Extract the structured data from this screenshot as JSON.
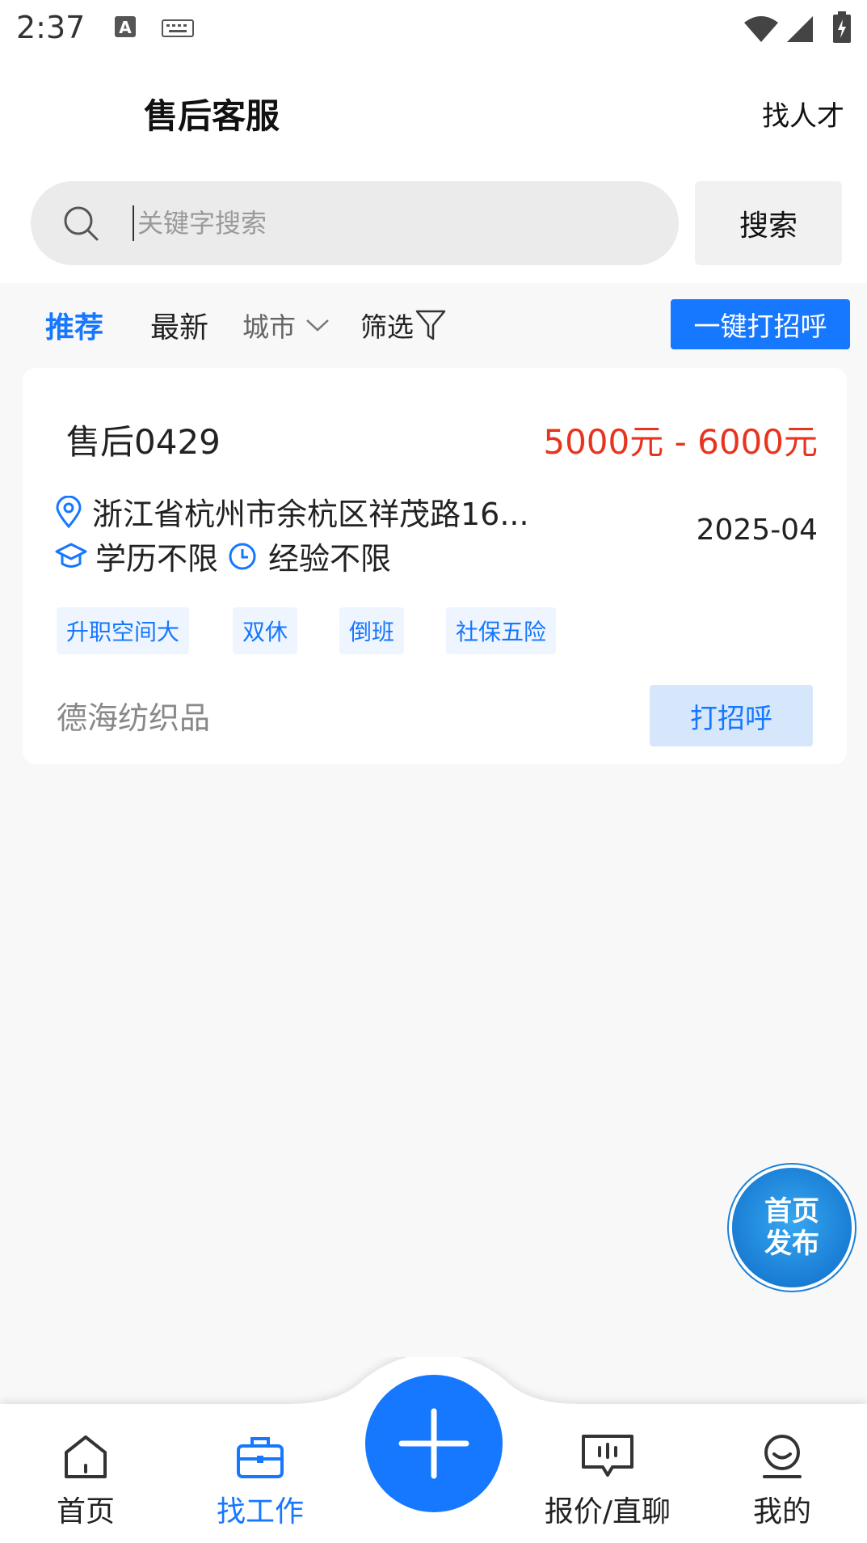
{
  "status_bar": {
    "time": "2:37"
  },
  "header": {
    "title": "售后客服",
    "find_talent": "找人才"
  },
  "search": {
    "placeholder": "关键字搜索",
    "button_label": "搜索"
  },
  "filters": {
    "tab_recommend": "推荐",
    "tab_latest": "最新",
    "city": "城市",
    "filter": "筛选",
    "greet_all": "一键打招呼"
  },
  "job": {
    "title": "售后0429",
    "salary": "5000元 - 6000元",
    "address": "浙江省杭州市余杭区祥茂路16...",
    "education": "学历不限",
    "experience": "经验不限",
    "date": "2025-04",
    "tags": [
      "升职空间大",
      "双休",
      "倒班",
      "社保五险"
    ],
    "company": "德海纺织品",
    "greet_button": "打招呼"
  },
  "fab": {
    "line1": "首页",
    "line2": "发布"
  },
  "bottom_nav": {
    "home": "首页",
    "jobs": "找工作",
    "chat": "报价/直聊",
    "mine": "我的"
  },
  "colors": {
    "accent": "#1677ff",
    "salary": "#e8341f",
    "tag_bg": "#eef5ff",
    "greet_bg": "#d7e7fb"
  }
}
